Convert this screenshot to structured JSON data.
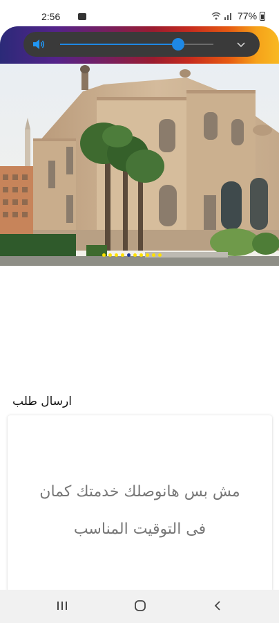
{
  "status_bar": {
    "time": "2:56",
    "battery": "77%",
    "icons": [
      "message-icon",
      "wifi-icon",
      "signal-icon",
      "battery-icon"
    ]
  },
  "player": {
    "progress": 0.77,
    "icons": [
      "volume-icon",
      "chevron-down-icon"
    ],
    "accent_color": "#1e88e5"
  },
  "banner": {
    "slide_count": 10,
    "active_slide": 4,
    "dot_color": "#ffe100",
    "active_dot_color": "#1e3a9c"
  },
  "request_section": {
    "title": "ارسال طلب",
    "card_text_line1": "مش بس هانوصلك خدمتك كمان",
    "card_text_line2": "فى التوقيت المناسب"
  },
  "nav_bar": {
    "icons": [
      "recents-icon",
      "home-icon",
      "back-icon"
    ]
  }
}
